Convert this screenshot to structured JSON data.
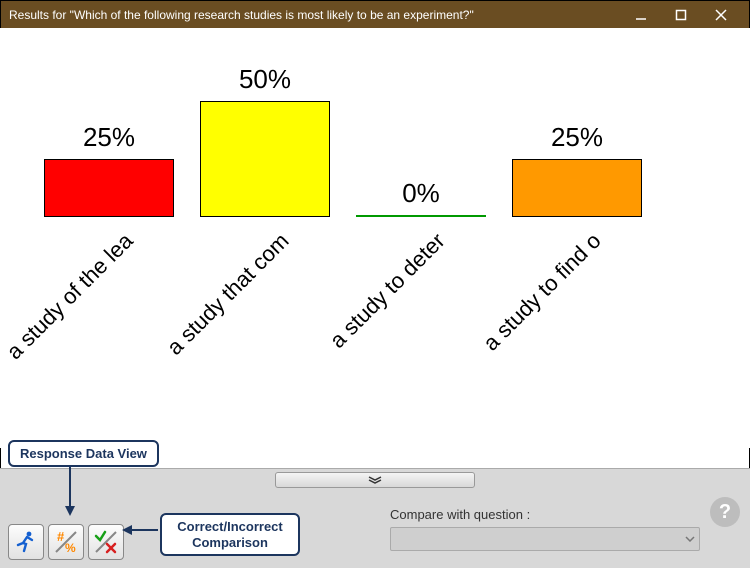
{
  "window": {
    "title": "Results for \"Which of the following research studies is most likely to be an experiment?\""
  },
  "chart_data": {
    "type": "bar",
    "title": "",
    "xlabel": "",
    "ylabel": "",
    "ylim": [
      0,
      50
    ],
    "categories": [
      "a study of the lea",
      "a study that com",
      "a study to deter",
      "a study to find o"
    ],
    "values": [
      25,
      50,
      0,
      25
    ],
    "value_labels": [
      "25%",
      "50%",
      "0%",
      "25%"
    ],
    "colors": [
      "#ff0000",
      "#ffff00",
      "#009900",
      "#ff9900"
    ]
  },
  "callouts": {
    "response_data_view": "Response Data View",
    "correct_incorrect": "Correct/Incorrect Comparison"
  },
  "footer": {
    "compare_label": "Compare with question :",
    "help": "?"
  }
}
